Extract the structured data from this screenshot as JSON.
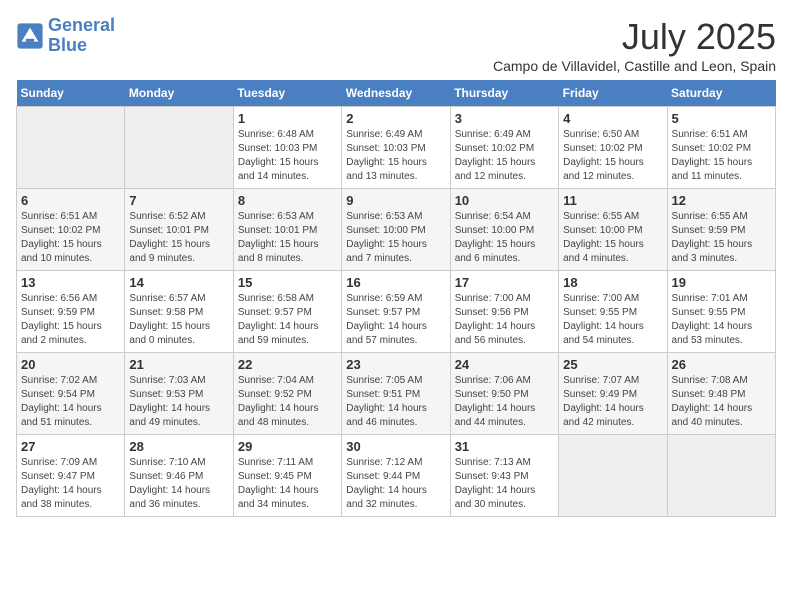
{
  "header": {
    "logo_general": "General",
    "logo_blue": "Blue",
    "month": "July 2025",
    "location": "Campo de Villavidel, Castille and Leon, Spain"
  },
  "days_of_week": [
    "Sunday",
    "Monday",
    "Tuesday",
    "Wednesday",
    "Thursday",
    "Friday",
    "Saturday"
  ],
  "weeks": [
    [
      {
        "day": "",
        "info": ""
      },
      {
        "day": "",
        "info": ""
      },
      {
        "day": "1",
        "info": "Sunrise: 6:48 AM\nSunset: 10:03 PM\nDaylight: 15 hours\nand 14 minutes."
      },
      {
        "day": "2",
        "info": "Sunrise: 6:49 AM\nSunset: 10:03 PM\nDaylight: 15 hours\nand 13 minutes."
      },
      {
        "day": "3",
        "info": "Sunrise: 6:49 AM\nSunset: 10:02 PM\nDaylight: 15 hours\nand 12 minutes."
      },
      {
        "day": "4",
        "info": "Sunrise: 6:50 AM\nSunset: 10:02 PM\nDaylight: 15 hours\nand 12 minutes."
      },
      {
        "day": "5",
        "info": "Sunrise: 6:51 AM\nSunset: 10:02 PM\nDaylight: 15 hours\nand 11 minutes."
      }
    ],
    [
      {
        "day": "6",
        "info": "Sunrise: 6:51 AM\nSunset: 10:02 PM\nDaylight: 15 hours\nand 10 minutes."
      },
      {
        "day": "7",
        "info": "Sunrise: 6:52 AM\nSunset: 10:01 PM\nDaylight: 15 hours\nand 9 minutes."
      },
      {
        "day": "8",
        "info": "Sunrise: 6:53 AM\nSunset: 10:01 PM\nDaylight: 15 hours\nand 8 minutes."
      },
      {
        "day": "9",
        "info": "Sunrise: 6:53 AM\nSunset: 10:00 PM\nDaylight: 15 hours\nand 7 minutes."
      },
      {
        "day": "10",
        "info": "Sunrise: 6:54 AM\nSunset: 10:00 PM\nDaylight: 15 hours\nand 6 minutes."
      },
      {
        "day": "11",
        "info": "Sunrise: 6:55 AM\nSunset: 10:00 PM\nDaylight: 15 hours\nand 4 minutes."
      },
      {
        "day": "12",
        "info": "Sunrise: 6:55 AM\nSunset: 9:59 PM\nDaylight: 15 hours\nand 3 minutes."
      }
    ],
    [
      {
        "day": "13",
        "info": "Sunrise: 6:56 AM\nSunset: 9:59 PM\nDaylight: 15 hours\nand 2 minutes."
      },
      {
        "day": "14",
        "info": "Sunrise: 6:57 AM\nSunset: 9:58 PM\nDaylight: 15 hours\nand 0 minutes."
      },
      {
        "day": "15",
        "info": "Sunrise: 6:58 AM\nSunset: 9:57 PM\nDaylight: 14 hours\nand 59 minutes."
      },
      {
        "day": "16",
        "info": "Sunrise: 6:59 AM\nSunset: 9:57 PM\nDaylight: 14 hours\nand 57 minutes."
      },
      {
        "day": "17",
        "info": "Sunrise: 7:00 AM\nSunset: 9:56 PM\nDaylight: 14 hours\nand 56 minutes."
      },
      {
        "day": "18",
        "info": "Sunrise: 7:00 AM\nSunset: 9:55 PM\nDaylight: 14 hours\nand 54 minutes."
      },
      {
        "day": "19",
        "info": "Sunrise: 7:01 AM\nSunset: 9:55 PM\nDaylight: 14 hours\nand 53 minutes."
      }
    ],
    [
      {
        "day": "20",
        "info": "Sunrise: 7:02 AM\nSunset: 9:54 PM\nDaylight: 14 hours\nand 51 minutes."
      },
      {
        "day": "21",
        "info": "Sunrise: 7:03 AM\nSunset: 9:53 PM\nDaylight: 14 hours\nand 49 minutes."
      },
      {
        "day": "22",
        "info": "Sunrise: 7:04 AM\nSunset: 9:52 PM\nDaylight: 14 hours\nand 48 minutes."
      },
      {
        "day": "23",
        "info": "Sunrise: 7:05 AM\nSunset: 9:51 PM\nDaylight: 14 hours\nand 46 minutes."
      },
      {
        "day": "24",
        "info": "Sunrise: 7:06 AM\nSunset: 9:50 PM\nDaylight: 14 hours\nand 44 minutes."
      },
      {
        "day": "25",
        "info": "Sunrise: 7:07 AM\nSunset: 9:49 PM\nDaylight: 14 hours\nand 42 minutes."
      },
      {
        "day": "26",
        "info": "Sunrise: 7:08 AM\nSunset: 9:48 PM\nDaylight: 14 hours\nand 40 minutes."
      }
    ],
    [
      {
        "day": "27",
        "info": "Sunrise: 7:09 AM\nSunset: 9:47 PM\nDaylight: 14 hours\nand 38 minutes."
      },
      {
        "day": "28",
        "info": "Sunrise: 7:10 AM\nSunset: 9:46 PM\nDaylight: 14 hours\nand 36 minutes."
      },
      {
        "day": "29",
        "info": "Sunrise: 7:11 AM\nSunset: 9:45 PM\nDaylight: 14 hours\nand 34 minutes."
      },
      {
        "day": "30",
        "info": "Sunrise: 7:12 AM\nSunset: 9:44 PM\nDaylight: 14 hours\nand 32 minutes."
      },
      {
        "day": "31",
        "info": "Sunrise: 7:13 AM\nSunset: 9:43 PM\nDaylight: 14 hours\nand 30 minutes."
      },
      {
        "day": "",
        "info": ""
      },
      {
        "day": "",
        "info": ""
      }
    ]
  ]
}
